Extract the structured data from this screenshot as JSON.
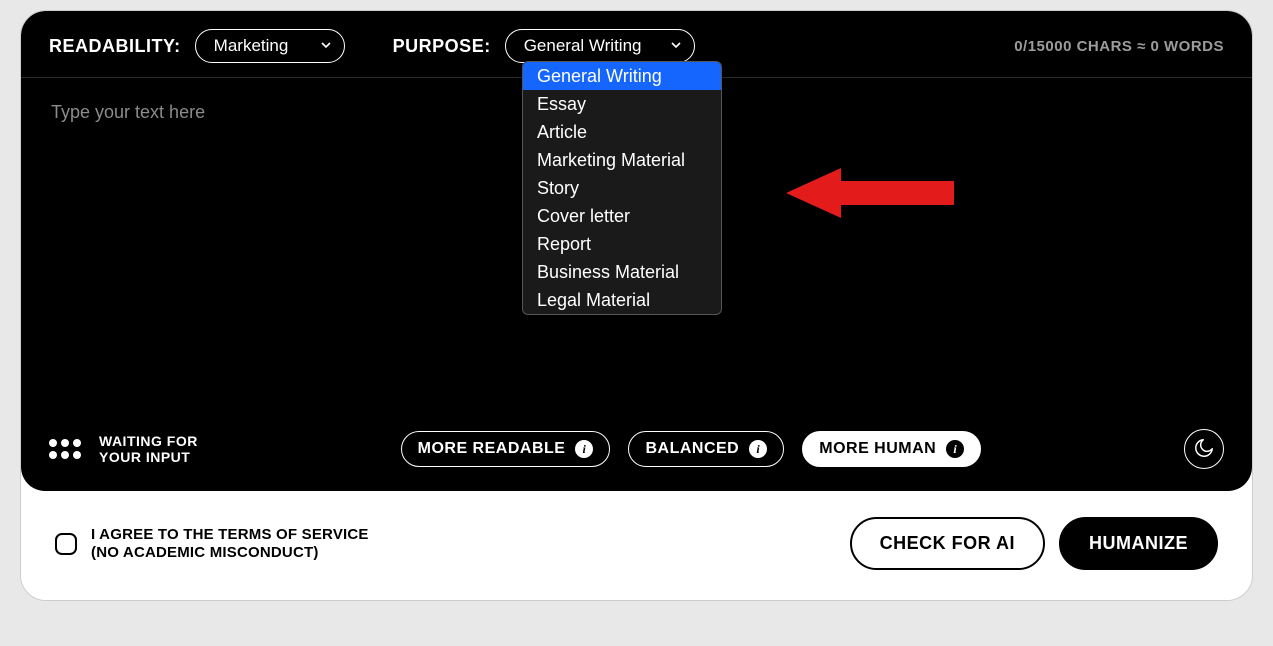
{
  "header": {
    "readability_label": "READABILITY:",
    "readability_value": "Marketing",
    "purpose_label": "PURPOSE:",
    "purpose_value": "General Writing",
    "counter_text": "0/15000 CHARS ≈ 0 WORDS"
  },
  "editor": {
    "placeholder": "Type your text here"
  },
  "purpose_dropdown": {
    "options": [
      "General Writing",
      "Essay",
      "Article",
      "Marketing Material",
      "Story",
      "Cover letter",
      "Report",
      "Business Material",
      "Legal Material"
    ],
    "selected_index": 0
  },
  "status": {
    "line1": "WAITING FOR",
    "line2": "YOUR INPUT"
  },
  "modes": {
    "more_readable": "MORE READABLE",
    "balanced": "BALANCED",
    "more_human": "MORE HUMAN",
    "active": "more_human"
  },
  "footer": {
    "agree_line1": "I AGREE TO THE TERMS OF SERVICE",
    "agree_line2": "(NO ACADEMIC MISCONDUCT)",
    "check_button": "CHECK FOR AI",
    "humanize_button": "HUMANIZE"
  },
  "annotation": {
    "arrow_color": "#e31b1b"
  }
}
